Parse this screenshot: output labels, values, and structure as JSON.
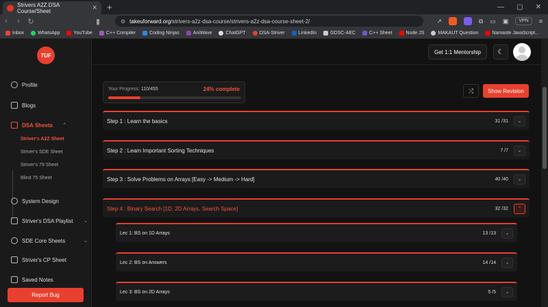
{
  "browser": {
    "tab_title": "Strivers A2Z DSA Course/Sheet",
    "tab_close": "✕",
    "new_tab": "+",
    "url_host": "takeuforward.org",
    "url_path": "/strivers-a2z-dsa-course/strivers-a2z-dsa-course-sheet-2/",
    "vpn_label": "VPN",
    "win_min": "—",
    "win_max": "▢",
    "win_close": "✕",
    "bookmarks": [
      "Inbox",
      "WhatsApp",
      "YouTube",
      "C++ Compiler",
      "Coding Ninjas",
      "AniWave",
      "ChatGPT",
      "DSA-Striver",
      "LinkedIn",
      "GDSC-AEC",
      "C++ Sheet",
      "Node JS",
      "MAKAUT Question",
      "Namaste JavaScript..."
    ]
  },
  "sidebar": {
    "logo": "TUF",
    "profile": "Profile",
    "blogs": "Blogs",
    "dsa_sheets": "DSA Sheets",
    "sub_items": [
      "Striver's A2Z Sheet",
      "Striver's SDE Sheet",
      "Striver's 79 Sheet",
      "Blind 75 Sheet"
    ],
    "system_design": "System Design",
    "dsa_playlist": "Striver's DSA Playlist",
    "sde_core": "SDE Core Sheets",
    "cp_sheet": "Striver's CP Sheet",
    "saved_notes": "Saved Notes",
    "report_bug": "Report Bug"
  },
  "header": {
    "mentorship": "Get 1:1 Mentorship",
    "moon": "☾"
  },
  "progress": {
    "label": "Your Progress:",
    "value": "110/455",
    "percent_text": "24% complete",
    "fraction": 0.24
  },
  "actions": {
    "shuffle": "⤮",
    "show_revision": "Show Revision"
  },
  "steps": [
    {
      "title": "Step 1 : Learn the basics",
      "count": "31 /31"
    },
    {
      "title": "Step 2 : Learn Important Sorting Techniques",
      "count": "7 /7"
    },
    {
      "title": "Step 3 : Solve Problems on Arrays [Easy -> Medium -> Hard]",
      "count": "40 /40"
    },
    {
      "title": "Step 4 : Binary Search [1D, 2D Arrays, Search Space]",
      "count": "32 /32"
    }
  ],
  "lectures": [
    {
      "title": "Lec 1: BS on 1D Arrays",
      "count": "13 /13"
    },
    {
      "title": "Lec 2: BS on Answers",
      "count": "14 /14"
    },
    {
      "title": "Lec 3: BS on 2D Arrays",
      "count": "5 /5"
    }
  ],
  "colors": {
    "accent": "#e8402e",
    "bg": "#121212"
  }
}
